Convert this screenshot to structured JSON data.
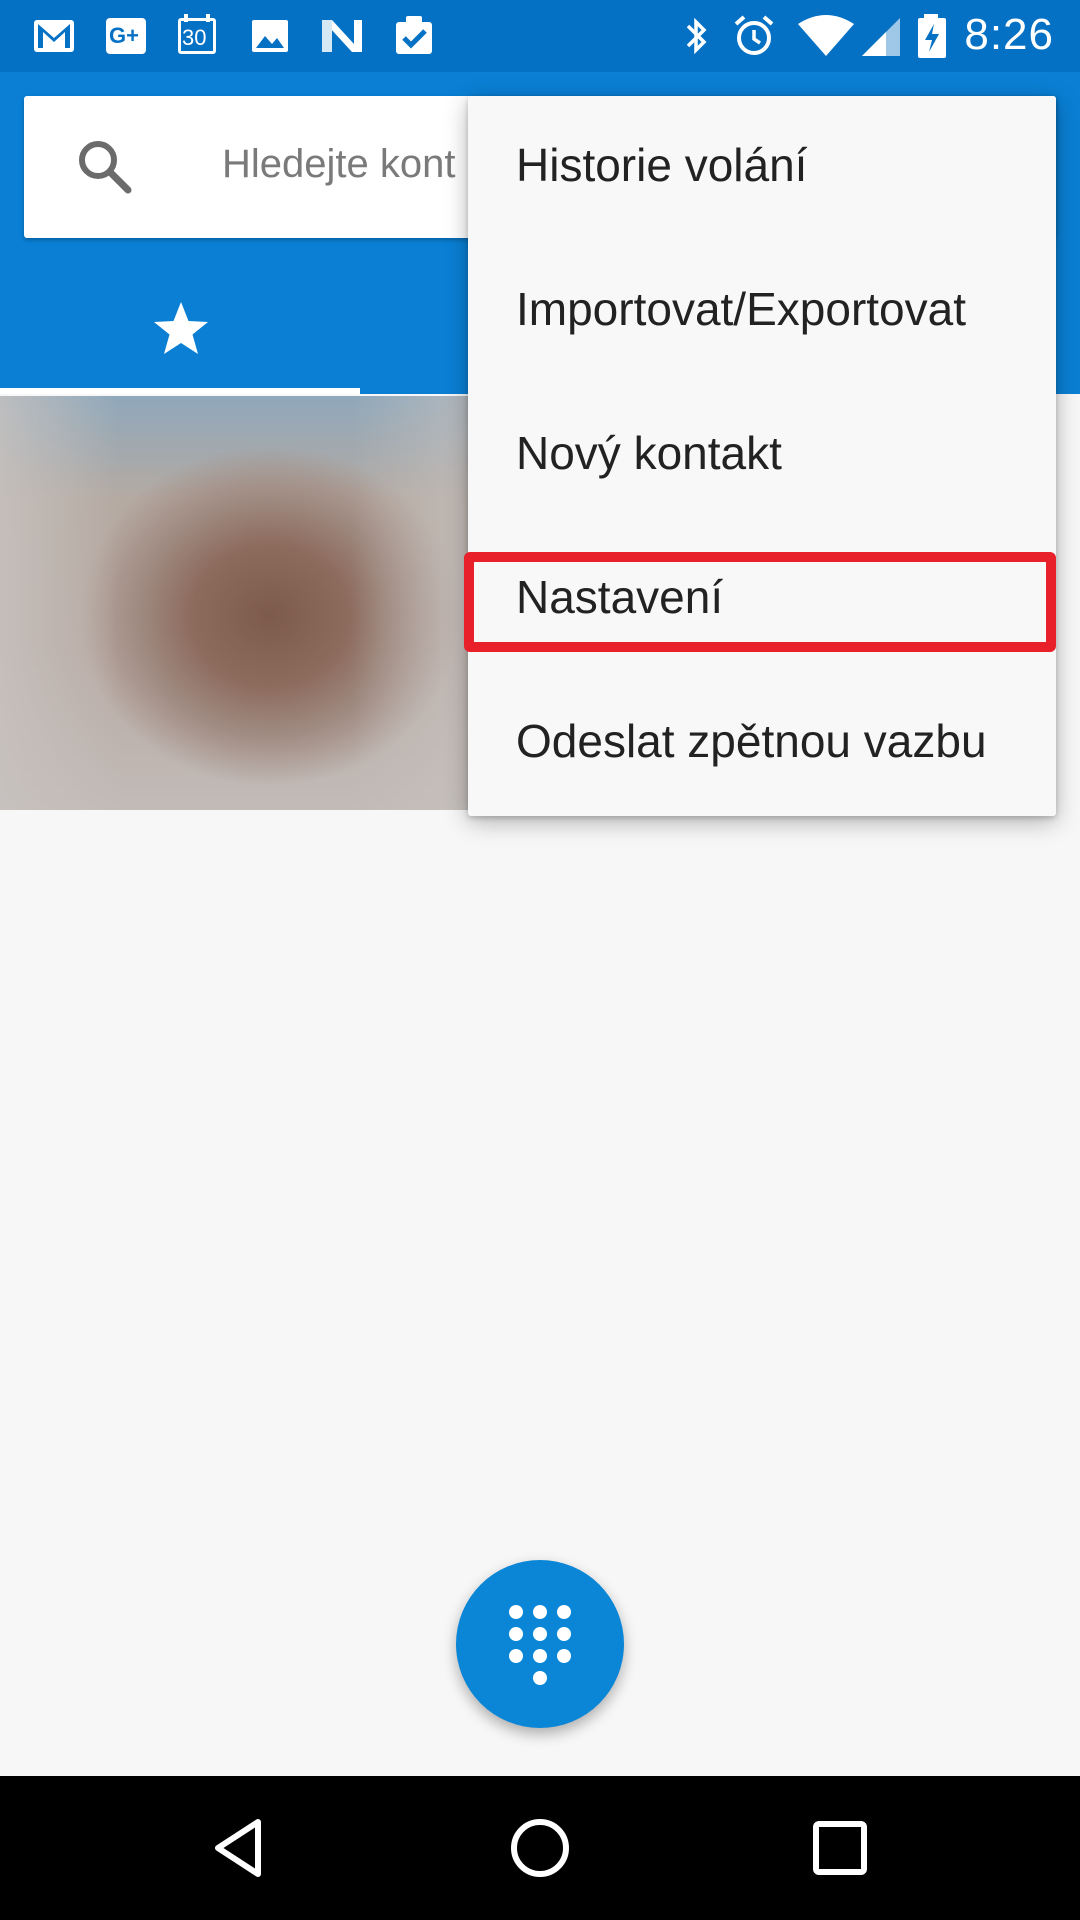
{
  "status_bar": {
    "time": "8:26",
    "left_icons": [
      "gmail-icon",
      "google-plus-icon",
      "calendar-icon",
      "photos-icon",
      "n-app-icon",
      "tasks-icon"
    ],
    "right_icons": [
      "bluetooth-icon",
      "alarm-icon",
      "wifi-icon",
      "signal-icon",
      "battery-charging-icon"
    ],
    "calendar_day": "30",
    "gplus_label": "G+"
  },
  "search": {
    "placeholder": "Hledejte kont"
  },
  "tabs": [
    {
      "icon": "star-icon",
      "selected": true
    }
  ],
  "menu": {
    "items": [
      {
        "label": "Historie volání"
      },
      {
        "label": "Importovat/Exportovat"
      },
      {
        "label": "Nový kontakt"
      },
      {
        "label": "Nastavení",
        "highlighted": true
      },
      {
        "label": "Odeslat zpětnou vazbu"
      }
    ]
  },
  "colors": {
    "app_bar": "#0a7fd4",
    "status_bar": "#0571c4",
    "highlight": "#e8202a",
    "fab": "#0b86d6"
  },
  "fab": {
    "icon": "dialpad-icon"
  },
  "nav": {
    "icons": [
      "back-icon",
      "home-icon",
      "recents-icon"
    ]
  }
}
